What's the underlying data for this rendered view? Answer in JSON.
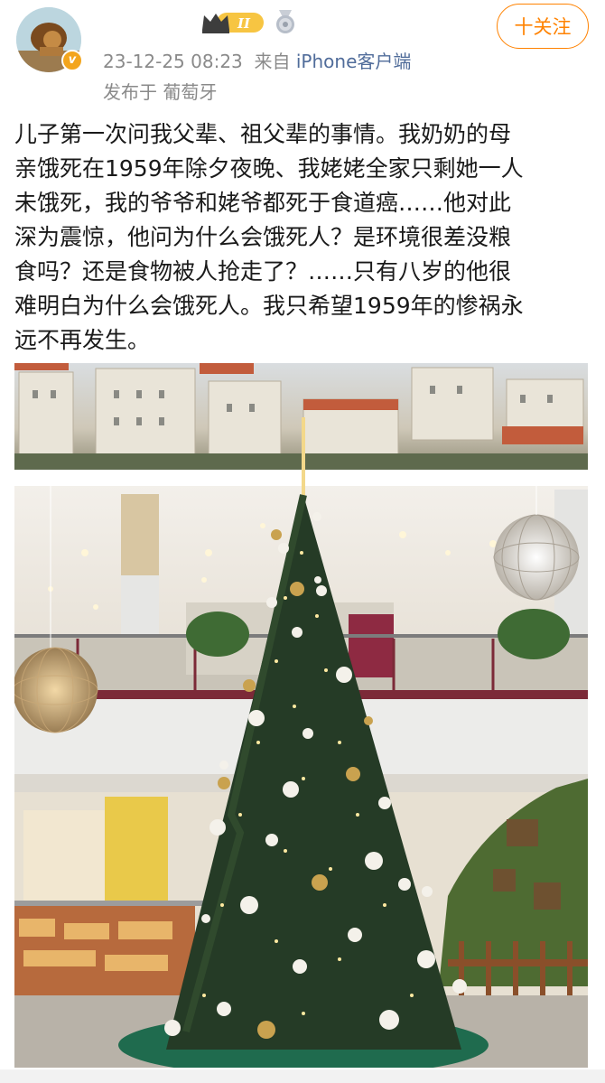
{
  "post": {
    "vip_level": "II",
    "verified_mark": "v",
    "timestamp": "23-12-25 08:23",
    "source_prefix": "来自",
    "source": "iPhone客户端",
    "location": "发布于 葡萄牙",
    "follow_label": "十关注",
    "content": "儿子第一次问我父辈、祖父辈的事情。我奶奶的母\n亲饿死在1959年除夕夜晚、我姥姥全家只剩她一人\n未饿死，我的爷爷和姥爷都死于食道癌……他对此\n深为震惊，他问为什么会饿死人？是环境很差没粮\n食吗？还是食物被人抢走了？……只有八岁的他很\n难明白为什么会饿死人。我只希望1959年的惨祸永\n远不再发生。"
  },
  "colors": {
    "accent": "#ff8200",
    "meta_text": "#8a8a8a",
    "source_link": "#506c9a",
    "body_text": "#1a1a1a"
  },
  "icons": [
    "avatar-lion",
    "verified-badge",
    "vip-crown-badge",
    "medal-icon",
    "christmas-tree-photo"
  ]
}
